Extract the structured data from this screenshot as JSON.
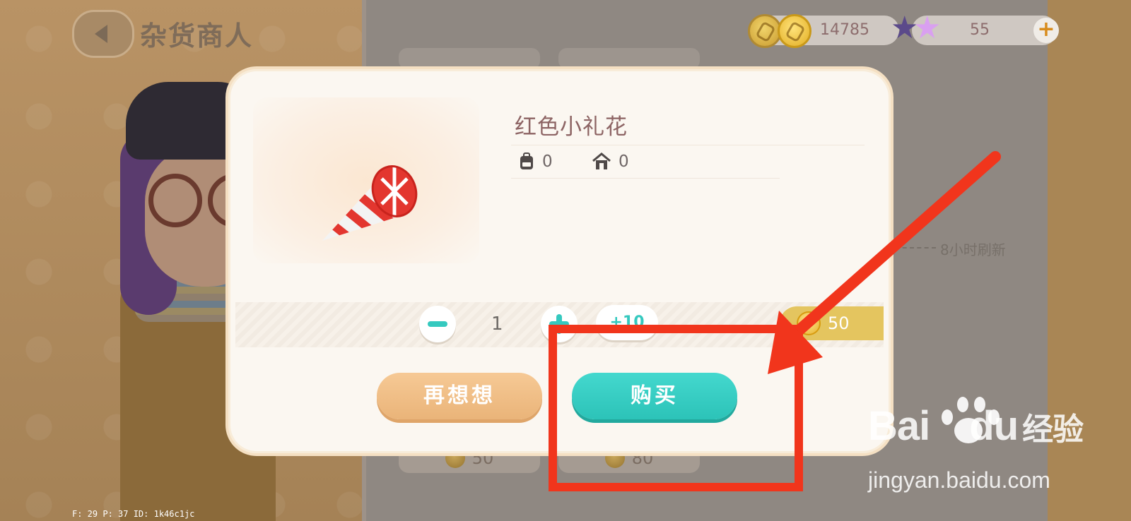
{
  "header": {
    "shop_title": "杂货商人",
    "coins": "14785",
    "stars": "55",
    "plus": "+"
  },
  "shop": {
    "refresh_text": "8小时刷新",
    "cards": [
      {
        "price": "50"
      },
      {
        "price": "80"
      }
    ]
  },
  "dialog": {
    "item_name": "红色小礼花",
    "backpack_count": "0",
    "home_count": "0",
    "quantity": "1",
    "plus_ten": "+10",
    "total_price": "50",
    "cancel_label": "再想想",
    "buy_label": "购买"
  },
  "watermark": {
    "logo_left": "Bai",
    "logo_mid": "du",
    "logo_right": "经验",
    "url": "jingyan.baidu.com"
  },
  "debug": {
    "text": "F: 29    P: 37    ID: 1k46c1jc"
  },
  "colors": {
    "accent_teal": "#35c9bf",
    "accent_orange": "#eab479",
    "annotation_red": "#f1351c"
  },
  "icons": [
    "back-arrow-icon",
    "coin-icon",
    "star-icon",
    "plus-icon",
    "backpack-icon",
    "home-icon",
    "minus-icon",
    "plus-icon",
    "coin-icon"
  ]
}
